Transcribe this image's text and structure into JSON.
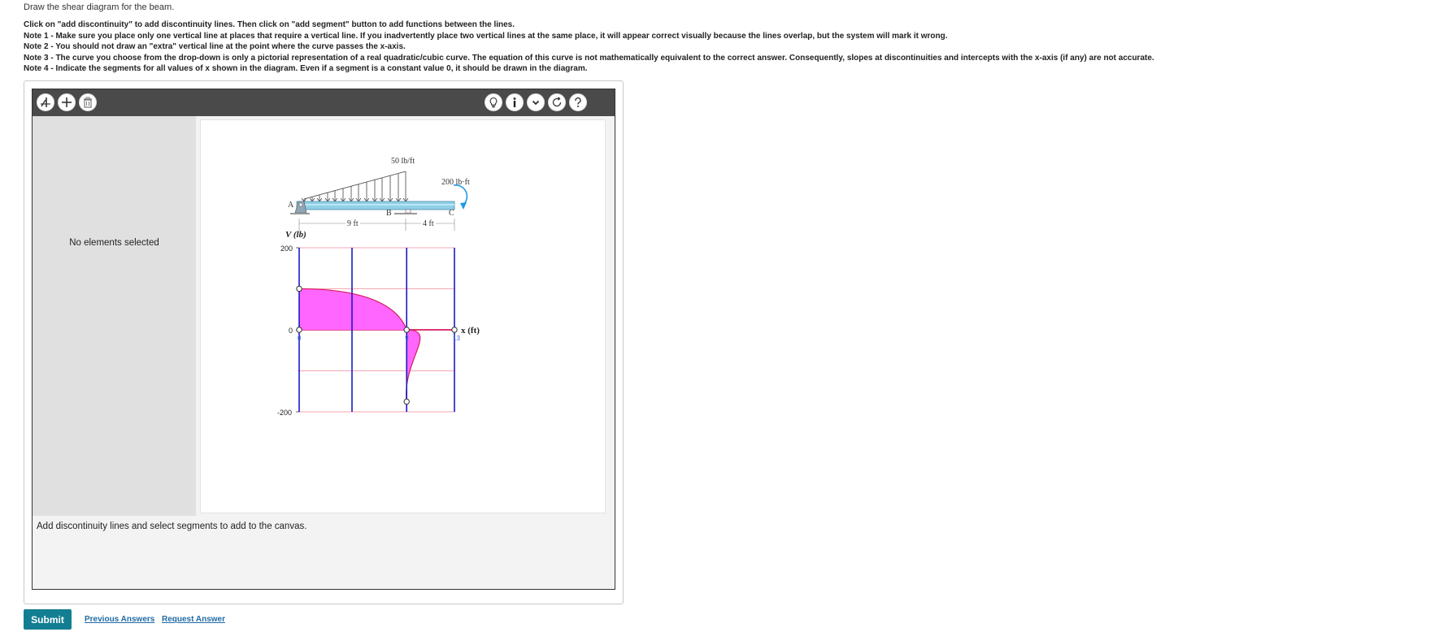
{
  "prompt": "Draw the shear diagram for the beam.",
  "instructions": [
    "Click on \"add discontinuity\" to add discontinuity lines. Then click on \"add segment\" button to add functions between the lines.",
    "Note 1 - Make sure you place only one vertical line at places that require a vertical line. If you inadvertently place two vertical lines at the same place, it will appear correct visually because the lines overlap, but the system will mark it wrong.",
    "Note 2 - You should not draw an \"extra\" vertical line at the point where the curve passes the x-axis.",
    "Note 3 - The curve you choose from the drop-down is only a pictorial representation of a real quadratic/cubic curve. The equation of this curve is not mathematically equivalent to the correct answer. Consequently, slopes at discontinuities and intercepts with the x-axis (if any) are not accurate.",
    "Note 4 - Indicate the segments for all values of x shown in the diagram. Even if a segment is a constant value 0, it should be drawn in the diagram."
  ],
  "toolbar": {
    "left_tools": [
      "add-discontinuity",
      "add-segment",
      "delete"
    ],
    "right_tools": [
      "hint",
      "info",
      "dropdown",
      "reset",
      "help"
    ]
  },
  "sidebar": {
    "message": "No elements selected"
  },
  "status_message": "Add discontinuity lines and select segments to add to the canvas.",
  "beam": {
    "load_label": "50 lb/ft",
    "moment_label": "200 lb·ft",
    "support_a": "A",
    "support_b": "B",
    "point_c": "C",
    "span1": "9 ft",
    "span2": "4 ft"
  },
  "graph": {
    "y_axis_label": "V (lb)",
    "x_axis_label": "x (ft)",
    "y_ticks": [
      "200",
      "0",
      "-200"
    ],
    "x_marks": [
      "0",
      "9",
      "13"
    ]
  },
  "chart_data": {
    "type": "line",
    "x_label": "x (ft)",
    "y_label": "V (lb)",
    "ylim": [
      -200,
      200
    ],
    "discontinuities_x": [
      0,
      9,
      13
    ],
    "series": [
      {
        "values": [
          [
            0,
            0
          ],
          [
            0,
            100
          ],
          [
            9,
            0
          ]
        ]
      },
      {
        "values": [
          [
            9,
            0
          ],
          [
            9,
            -175
          ],
          [
            13,
            0
          ]
        ]
      },
      {
        "values": [
          [
            13,
            0
          ],
          [
            13,
            0
          ]
        ]
      }
    ]
  },
  "colors": {
    "discontinuity_line": "#1a1ac8",
    "curve": "#d81b60",
    "fill": "#ff66ff",
    "grid": "#f08a9a",
    "toolbar": "#4a4a4a",
    "submit": "#137e92",
    "link": "#1f6aa5"
  },
  "buttons": {
    "submit": "Submit",
    "previous_answers": "Previous Answers",
    "request_answer": "Request Answer"
  }
}
